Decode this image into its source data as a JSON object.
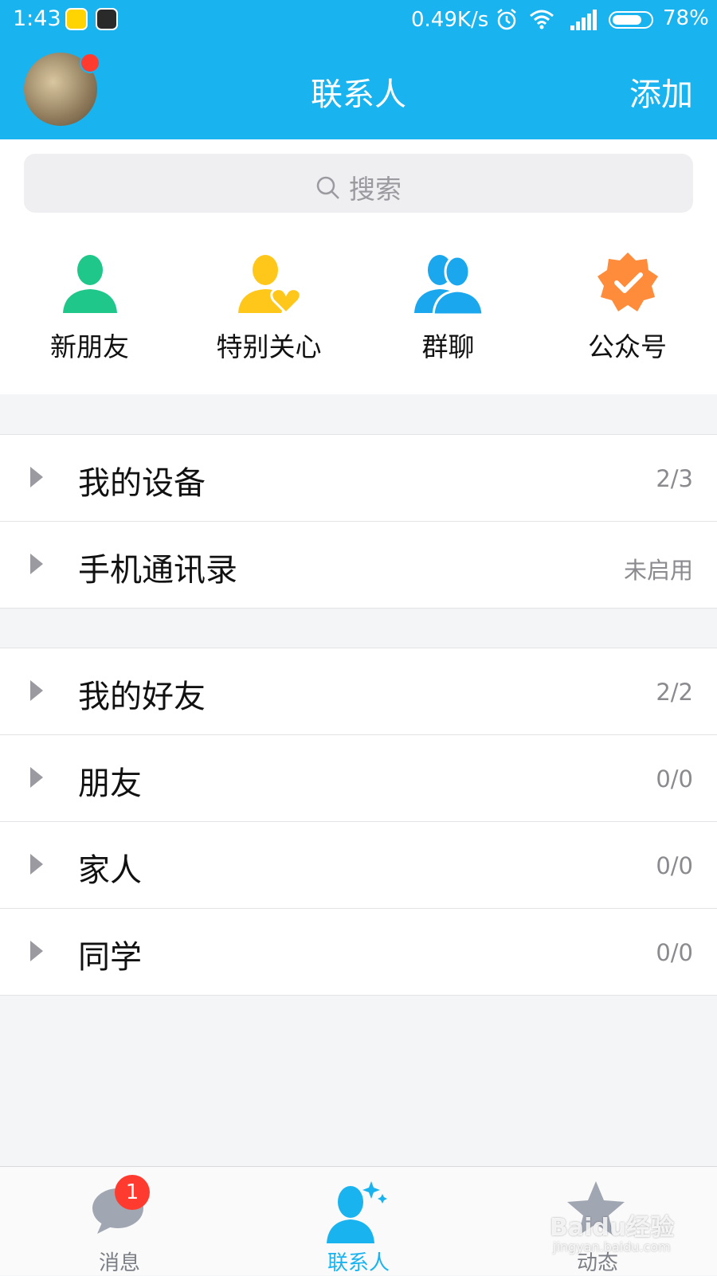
{
  "status_bar": {
    "time": "1:43",
    "network_speed": "0.49K/s",
    "battery_percent": "78%",
    "battery_level": 0.78,
    "icons": [
      "music-app-icon",
      "app-icon",
      "alarm-icon",
      "wifi-icon",
      "signal-icon",
      "battery-icon"
    ]
  },
  "header": {
    "title": "联系人",
    "add_label": "添加",
    "accent_color": "#19b4f0"
  },
  "search": {
    "placeholder": "搜索"
  },
  "quick_actions": [
    {
      "label": "新朋友",
      "icon": "new-friend-icon",
      "color": "#1fc78a"
    },
    {
      "label": "特别关心",
      "icon": "special-care-icon",
      "color": "#ffc71a"
    },
    {
      "label": "群聊",
      "icon": "group-chat-icon",
      "color": "#1aa7ee"
    },
    {
      "label": "公众号",
      "icon": "official-account-icon",
      "color": "#ff8c3a"
    }
  ],
  "groups_top": [
    {
      "label": "我的设备",
      "count": "2/3"
    },
    {
      "label": "手机通讯录",
      "count": "未启用"
    }
  ],
  "groups_friends": [
    {
      "label": "我的好友",
      "count": "2/2"
    },
    {
      "label": "朋友",
      "count": "0/0"
    },
    {
      "label": "家人",
      "count": "0/0"
    },
    {
      "label": "同学",
      "count": "0/0"
    }
  ],
  "tabs": [
    {
      "label": "消息",
      "icon": "message-icon",
      "badge": "1"
    },
    {
      "label": "联系人",
      "icon": "contacts-icon",
      "active": true
    },
    {
      "label": "动态",
      "icon": "star-icon"
    }
  ],
  "watermark": {
    "text": "Baidu经验",
    "url_text": "jingyan.baidu.com"
  }
}
